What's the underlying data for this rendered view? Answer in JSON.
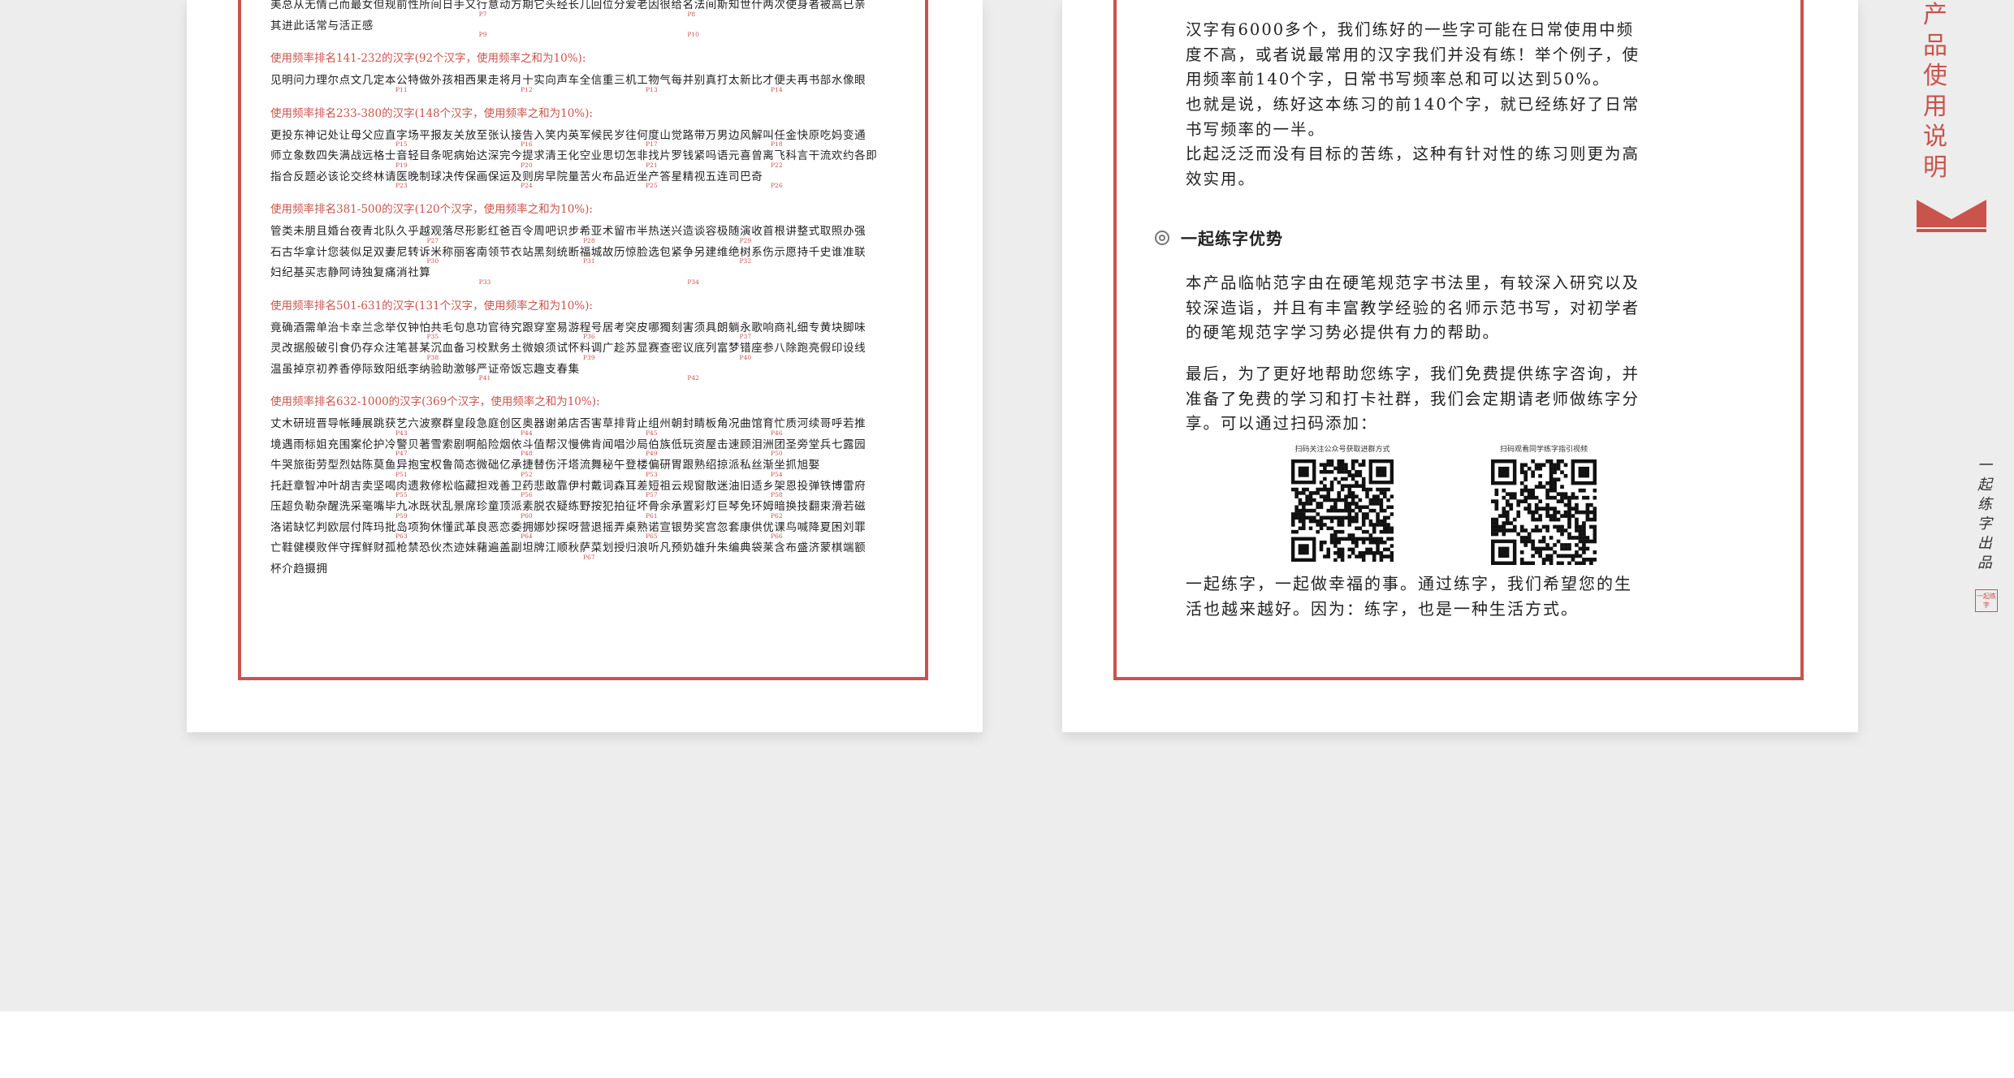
{
  "left_page": {
    "intro_lines": [
      "美总从无情己而最女但规前性所间日手又行意动方期它头经长几回位分爱老因很给名法间斯知世什两次使身者被高已亲",
      "其进此话常与活正感"
    ],
    "intro_refs": [
      "P7",
      "P8",
      "P9",
      "P10"
    ],
    "sections": [
      {
        "heading": "使用频率排名141-232的汉字(92个汉字，使用频率之和为10%):",
        "lines": [
          "见明问力理尔点文几定本公特做外孩相西果走将月十实向声车全信重三机工物气每并别真打太新比才便夫再书部水像眼"
        ],
        "refs": [
          "P11",
          "P12",
          "P13",
          "P14"
        ]
      },
      {
        "heading": "使用频率排名233-380的汉字(148个汉字，使用频率之和为10%):",
        "lines": [
          "更投东神记处让母父应直字场平报友关放至张认接告入笑内英军候民岁往何度山觉路带万男边风解叫任金快原吃妈变通",
          "师立象数四失满战远格士音轻目条呢病始达深完今提求清王化空业思切怎非找片罗钱紧吗语元喜曾离飞科言干流欢约各即",
          "指合反题必该论交终林请医晚制球决传保画保运及则房早院量苦火布品近坐产答星精视五连司巴奇"
        ],
        "refs": [
          "P15",
          "P16",
          "P17",
          "P18",
          "P19",
          "P20",
          "P21",
          "P22",
          "P23",
          "P24",
          "P25",
          "P26"
        ]
      },
      {
        "heading": "使用频率排名381-500的汉字(120个汉字，使用频率之和为10%):",
        "lines": [
          "管类未朋且婚台夜青北队久乎越观落尽形影红爸百令周吧识步希亚术留市半热送兴造谈容极随演收首根讲整式取照办强",
          "石古华拿计您装似足双妻尼转诉米称丽客南领节衣站黑刻统断福城故历惊脸选包紧争另建维绝树系伤示愿持千史谁准联",
          "妇纪基买志静阿诗独复痛消社算"
        ],
        "refs": [
          "P27",
          "P28",
          "P29",
          "P30",
          "P31",
          "P32",
          "P33",
          "P34"
        ]
      },
      {
        "heading": "使用频率排名501-631的汉字(131个汉字，使用频率之和为10%):",
        "lines": [
          "竟确酒需单治卡幸兰念举仅钟怕共毛句息功官待究跟穿室易游程号居考突皮哪獨刻害须具朗躺永歌响商礼细专黄块脚味",
          "灵改据般破引食仍存众注笔甚某沉血备习校默务土微娘须试怀料调广趁苏显赛查密议底列富梦错座参八除跑亮假印设线",
          "温虽掉京初养香停际致阳纸李纳验助激够严证帝饭忘趣支春集"
        ],
        "refs": [
          "P35",
          "P36",
          "P37",
          "P38",
          "P39",
          "P40",
          "P41",
          "P42"
        ]
      },
      {
        "heading": "使用频率排名632-1000的汉字(369个汉字，使用频率之和为10%):",
        "lines": [
          "丈木研班晋导帐睡展跳获艺六波察群皇段急庭创区奥器谢弟店否害草排背止组州朝封睛板角况曲馆育忙质河续哥呼若推",
          "境遇雨标姐充围案伦护冷警贝著雪索剧啊船险烟依斗值帮汉慢佛肯闻唱沙局伯族低玩资屋击速顾泪洲团圣旁堂兵七露园",
          "牛哭旅街劳型烈姑陈莫鱼异抱宝权鲁简态微础亿承捷替伤汗塔流舞秘午登楼偏研胃跟熟绍掠派私丝渐坐抓旭娶",
          "托赶章智冲叶胡吉卖坚喝肉遗救修松临藏担戏善卫药悲敢靠伊村戴词森耳差短祖云规窗散迷油旧适乡架恩投弹铁博雷府",
          "压超负勒杂醒洗采毫嘴毕九冰既状乱景席珍童顶派素脱农疑练野按犯拍征坏骨余承置彩灯巨琴免环姆暗换技翻束滑若磁",
          "洛诺缺忆判欧层付阵玛批岛项狗休懂武革良恶恋委拥娜妙探呀营退摇弄桌熟诺宣银势奖宫忽套康供优课鸟喊降夏困刘罪",
          "亡鞋健模败伴守挥鲜财孤枪禁恐伙杰迹妹藸遍盖副坦牌江顺秋萨菜划授归浪听凡预奶雄升朱编典袋莱含布盛济蒙棋端额",
          "杯介趋摄拥"
        ],
        "refs": [
          "P43",
          "P44",
          "P45",
          "P46",
          "P47",
          "P48",
          "P49",
          "P50",
          "P51",
          "P52",
          "P53",
          "P54",
          "P55",
          "P56",
          "P57",
          "P58",
          "P59",
          "P60",
          "P61",
          "P62",
          "P63",
          "P64",
          "P65",
          "P66",
          "P67"
        ]
      }
    ]
  },
  "right_page": {
    "paragraph_1": "汉字有6000多个，我们练好的一些字可能在日常使用中频度不高，或者说最常用的汉字我们并没有练！举个例子，使用频率前140个字，日常书写频率总和可以达到50%。",
    "paragraph_2": "也就是说，练好这本练习的前140个字，就已经练好了日常书写频率的一半。",
    "paragraph_3": "比起泛泛而没有目标的苦练，这种有针对性的练习则更为高效实用。",
    "section_heading": "一起练字优势",
    "paragraph_4": "本产品临帖范字由在硬笔规范字书法里，有较深入研究以及较深造诣，并且有丰富教学经验的名师示范书写，对初学者的硬笔规范字学习势必提供有力的帮助。",
    "paragraph_5": "最后，为了更好地帮助您练字，我们免费提供练字咨询，并准备了免费的学习和打卡社群，我们会定期请老师做练字分享。可以通过扫码添加：",
    "qr_left_caption": "扫码关注公众号获取进群方式",
    "qr_right_caption": "扫码观看同学练字指引视频",
    "closing": "一起练字，一起做幸福的事。通过练字，我们希望您的生活也越来越好。因为：练字，也是一种生活方式。",
    "vertical_title": "产品使用说明",
    "signature": "一起练字出品",
    "seal_text": "一起练字",
    "accent_color": "#c9544c"
  }
}
